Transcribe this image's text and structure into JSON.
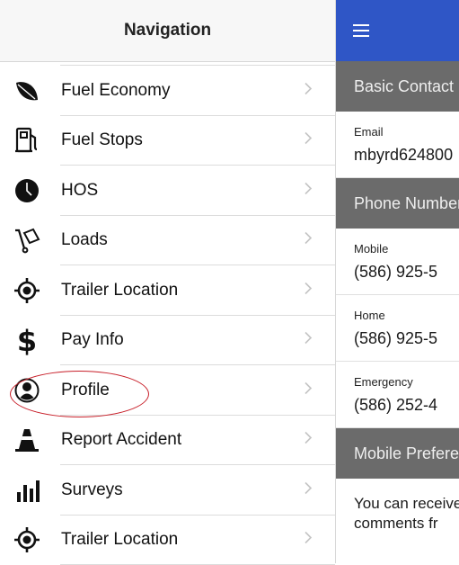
{
  "nav": {
    "title": "Navigation",
    "items": [
      {
        "label": "Fuel Economy",
        "icon": "leaf-icon"
      },
      {
        "label": "Fuel Stops",
        "icon": "fuel-pump-icon"
      },
      {
        "label": "HOS",
        "icon": "clock-icon"
      },
      {
        "label": "Loads",
        "icon": "hand-truck-icon"
      },
      {
        "label": "Trailer Location",
        "icon": "location-target-icon"
      },
      {
        "label": "Pay Info",
        "icon": "dollar-icon"
      },
      {
        "label": "Profile",
        "icon": "profile-icon"
      },
      {
        "label": "Report Accident",
        "icon": "traffic-cone-icon"
      },
      {
        "label": "Surveys",
        "icon": "bar-chart-icon"
      },
      {
        "label": "Trailer Location",
        "icon": "location-target-icon"
      }
    ]
  },
  "profile": {
    "sections": {
      "basic": "Basic Contact",
      "phone": "Phone Numbers",
      "mobile_prefs": "Mobile Preferences"
    },
    "email": {
      "label": "Email",
      "value": "mbyrd624800"
    },
    "phones": [
      {
        "label": "Mobile",
        "value": "(586) 925-5"
      },
      {
        "label": "Home",
        "value": "(586) 925-5"
      },
      {
        "label": "Emergency",
        "value": "(586) 252-4"
      }
    ],
    "note_lines": [
      "You can receive",
      "comments fr"
    ]
  },
  "colors": {
    "topbar": "#2f56c6",
    "section_header": "#6b6b6b",
    "highlight_ring": "#c8202a"
  }
}
